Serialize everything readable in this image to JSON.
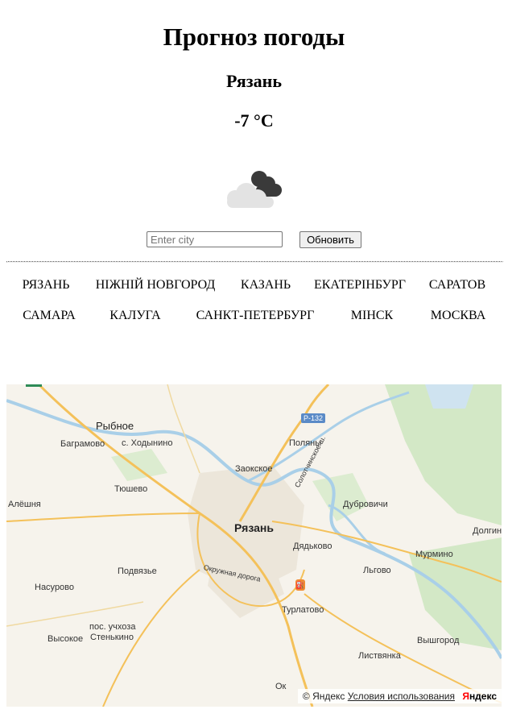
{
  "header": {
    "title": "Прогноз погоды",
    "city": "Рязань",
    "temperature": "-7 °C",
    "weather_icon": "cloudy-night-icon"
  },
  "form": {
    "input_placeholder": "Enter city",
    "input_value": "",
    "button_label": "Обновить"
  },
  "cities": [
    "РЯЗАНЬ",
    "НIЖНIЙ НОВГОРОД",
    "КАЗАНЬ",
    "ЕКАТЕРIНБУРГ",
    "САРАТОВ",
    "САМАРА",
    "КАЛУГА",
    "САНКТ-ПЕТЕРБУРГ",
    "МIНСК",
    "МОСКВА"
  ],
  "map": {
    "labels": {
      "rybnoe": "Рыбное",
      "bagramovo": "Баграмово",
      "khodynino": "с. Ходынино",
      "tyushevo": "Тюшево",
      "alyoshnya": "Алёшня",
      "zaokskoe": "Заокское",
      "polyany": "Поляны",
      "solotchinskoe": "Солотчинское ш.",
      "dubrovichi": "Дубровичи",
      "ryazan": "Рязань",
      "dolginino": "Долгин",
      "dyadkovo": "Дядьково",
      "murmino": "Мурмино",
      "podvyazye": "Подвязье",
      "lgovo": "Льгово",
      "okruzhnaya": "Окружная дорога",
      "nasurovo": "Насурово",
      "turlatovo": "Турлатово",
      "uchkhoza": "пос. учхоза",
      "stenkino": "Стенькино",
      "vysokoe": "Высокое",
      "vyshgorod": "Вышгород",
      "listvyanka": "Листвянка",
      "ok": "Ок"
    },
    "road_badge": "Р-132",
    "attribution": {
      "copyright": "© Яндекс",
      "terms": "Условия использования",
      "brand_first": "Я",
      "brand_rest": "ндекс"
    }
  },
  "colors": {
    "map_bg": "#f6f3ec",
    "road": "#f4c15a",
    "water": "#a9cfe8",
    "forest": "#d3e8c6",
    "city_area": "#ece6da"
  }
}
